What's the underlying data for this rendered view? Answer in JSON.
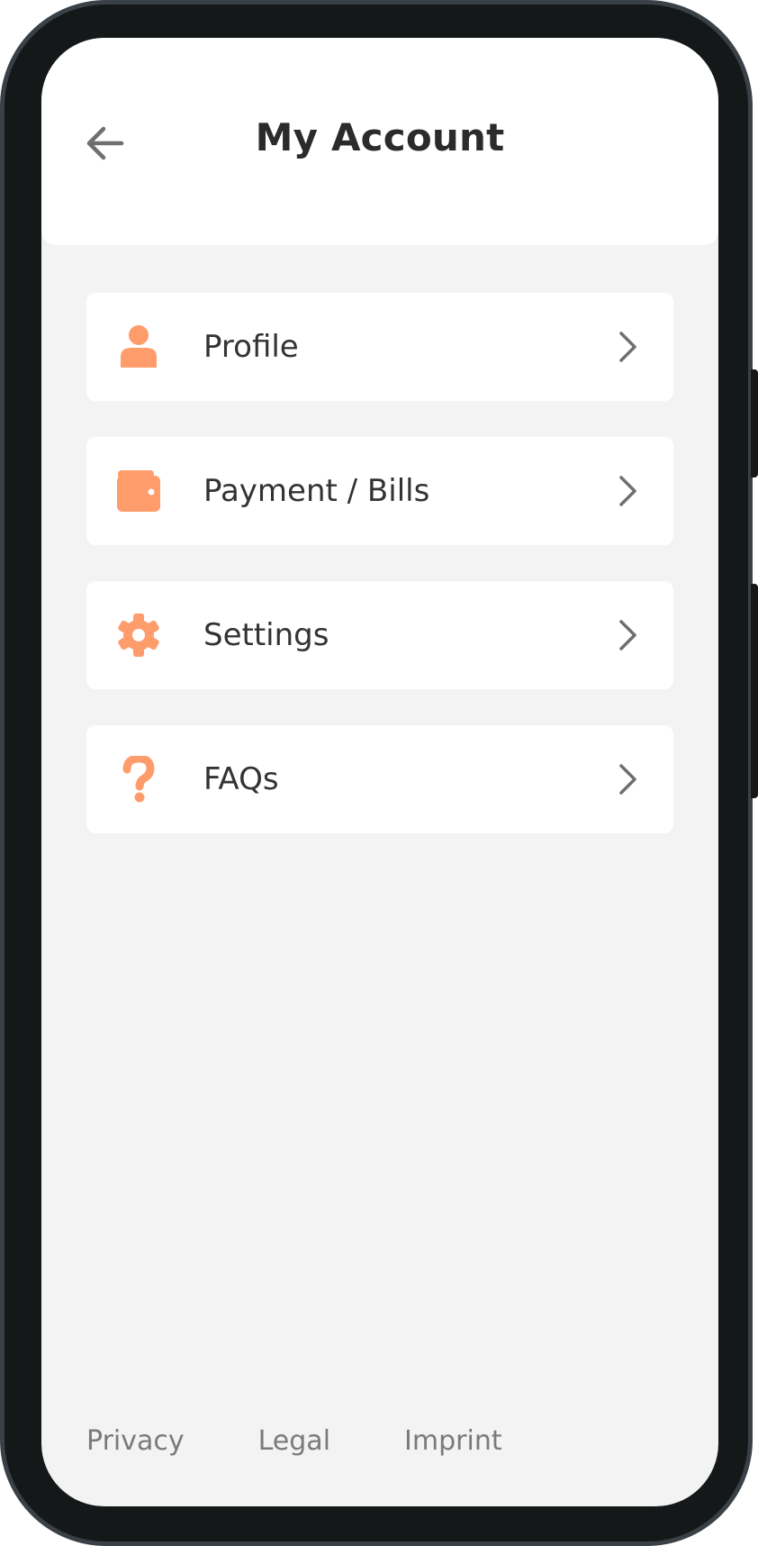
{
  "colors": {
    "accent": "#ff9c6b",
    "title": "#2b2b2b",
    "label": "#333333",
    "footer": "#7a7a7a",
    "background": "#f3f3f3",
    "card": "#ffffff"
  },
  "header": {
    "title": "My Account",
    "back_icon": "arrow-left-icon"
  },
  "menu": {
    "items": [
      {
        "label": "Profile",
        "icon": "user-icon"
      },
      {
        "label": "Payment / Bills",
        "icon": "wallet-icon"
      },
      {
        "label": "Settings",
        "icon": "gear-icon"
      },
      {
        "label": "FAQs",
        "icon": "question-icon"
      }
    ]
  },
  "footer": {
    "links": [
      "Privacy",
      "Legal",
      "Imprint"
    ]
  }
}
